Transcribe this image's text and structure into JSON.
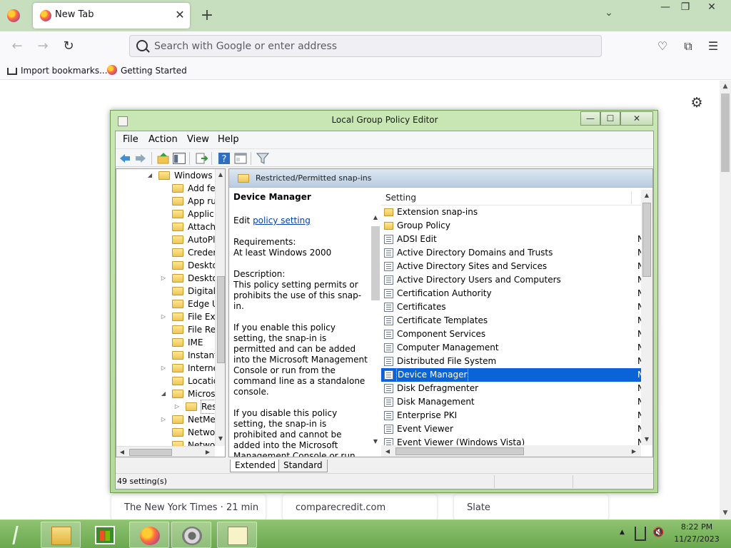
{
  "colors": {
    "tabstrip_bg": "#c7dfbf",
    "taskbar_bg": "#6aa84f",
    "selection_bg": "#0a64d8",
    "link": "#0645ad",
    "folder": "#f0c54f"
  },
  "browser": {
    "app_icon": "firefox-icon",
    "tab": {
      "title": "New Tab",
      "favicon": "firefox-icon",
      "close_glyph": "✕"
    },
    "new_tab_glyph": "+",
    "tab_list_glyph": "⌄",
    "window_controls": {
      "minimize": "—",
      "maximize": "❐",
      "close": "✕"
    },
    "nav": {
      "back_glyph": "←",
      "forward_glyph": "→",
      "reload_glyph": "↻"
    },
    "address_bar": {
      "placeholder": "Search with Google or enter address",
      "value": ""
    },
    "toolbar_icons": [
      "pocket-icon",
      "extensions-icon",
      "menu-icon"
    ],
    "toolbar_glyphs": {
      "pocket": "♡",
      "extensions": "⧉",
      "menu": "☰"
    },
    "bookmarks": [
      {
        "label": "Import bookmarks...",
        "icon": "import-icon"
      },
      {
        "label": "Getting Started",
        "icon": "firefox-icon"
      }
    ],
    "newtab": {
      "settings_glyph": "⚙",
      "cards": [
        "The New York Times · 21 min",
        "comparecredit.com",
        "Slate"
      ]
    }
  },
  "gpe": {
    "title": "Local Group Policy Editor",
    "controls": {
      "minimize": "—",
      "maximize": "☐",
      "close": "✕"
    },
    "menu": [
      "File",
      "Action",
      "View",
      "Help"
    ],
    "toolbar": [
      "back-icon",
      "forward-icon",
      "up-folder-icon",
      "show-hide-tree-icon",
      "export-list-icon",
      "help-icon",
      "properties-icon",
      "filter-icon"
    ],
    "tree": [
      {
        "label": "Windows (",
        "level": 0,
        "expander": "expanded"
      },
      {
        "label": "Add fe",
        "level": 1,
        "expander": "none"
      },
      {
        "label": "App ru",
        "level": 1,
        "expander": "none"
      },
      {
        "label": "Applic",
        "level": 1,
        "expander": "none"
      },
      {
        "label": "Attach",
        "level": 1,
        "expander": "none"
      },
      {
        "label": "AutoPl",
        "level": 1,
        "expander": "none"
      },
      {
        "label": "Creder",
        "level": 1,
        "expander": "none"
      },
      {
        "label": "Deskto",
        "level": 1,
        "expander": "none"
      },
      {
        "label": "Deskto",
        "level": 1,
        "expander": "collapsed"
      },
      {
        "label": "Digital",
        "level": 1,
        "expander": "none"
      },
      {
        "label": "Edge U",
        "level": 1,
        "expander": "none"
      },
      {
        "label": "File Exp",
        "level": 1,
        "expander": "collapsed"
      },
      {
        "label": "File Re",
        "level": 1,
        "expander": "none"
      },
      {
        "label": "IME",
        "level": 1,
        "expander": "none"
      },
      {
        "label": "Instant",
        "level": 1,
        "expander": "none"
      },
      {
        "label": "Interne",
        "level": 1,
        "expander": "collapsed"
      },
      {
        "label": "Locatio",
        "level": 1,
        "expander": "none"
      },
      {
        "label": "Micros",
        "level": 1,
        "expander": "expanded"
      },
      {
        "label": "Res",
        "level": 2,
        "expander": "collapsed",
        "selected": true
      },
      {
        "label": "NetMe",
        "level": 1,
        "expander": "collapsed"
      },
      {
        "label": "Netwo",
        "level": 1,
        "expander": "none"
      },
      {
        "label": "Netwo",
        "level": 1,
        "expander": "none"
      }
    ],
    "pane_header": "Restricted/Permitted snap-ins",
    "description": {
      "title": "Device Manager",
      "edit_prefix": "Edit ",
      "edit_link": "policy setting ",
      "requirements_label": "Requirements:",
      "requirements_value": "At least Windows 2000",
      "description_label": "Description:",
      "paragraphs": [
        "This policy setting permits or prohibits the use of this snap-in.",
        "If you enable this policy setting, the snap-in is permitted and can be added into the Microsoft Management Console or run from the command line as a standalone console.",
        "If you disable this policy setting, the snap-in is prohibited and cannot be added into the Microsoft Management Console or run from the command line as a standalone console. An error message is displayed stating that"
      ]
    },
    "list": {
      "column": "Setting",
      "rows": [
        {
          "name": "Extension snap-ins",
          "icon": "folder-icon",
          "state": ""
        },
        {
          "name": "Group Policy",
          "icon": "folder-icon",
          "state": ""
        },
        {
          "name": "ADSI Edit",
          "icon": "policy-setting-icon",
          "state": "N"
        },
        {
          "name": "Active Directory Domains and Trusts",
          "icon": "policy-setting-icon",
          "state": "N"
        },
        {
          "name": "Active Directory Sites and Services",
          "icon": "policy-setting-icon",
          "state": "N"
        },
        {
          "name": "Active Directory Users and Computers",
          "icon": "policy-setting-icon",
          "state": "N"
        },
        {
          "name": "Certification Authority",
          "icon": "policy-setting-icon",
          "state": "N"
        },
        {
          "name": "Certificates",
          "icon": "policy-setting-icon",
          "state": "N"
        },
        {
          "name": "Certificate Templates",
          "icon": "policy-setting-icon",
          "state": "N"
        },
        {
          "name": "Component Services",
          "icon": "policy-setting-icon",
          "state": "N"
        },
        {
          "name": "Computer Management",
          "icon": "policy-setting-icon",
          "state": "N"
        },
        {
          "name": "Distributed File System",
          "icon": "policy-setting-icon",
          "state": "N"
        },
        {
          "name": "Device Manager",
          "icon": "policy-setting-icon",
          "state": "N",
          "selected": true
        },
        {
          "name": "Disk Defragmenter",
          "icon": "policy-setting-icon",
          "state": "N"
        },
        {
          "name": "Disk Management",
          "icon": "policy-setting-icon",
          "state": "N"
        },
        {
          "name": "Enterprise PKI",
          "icon": "policy-setting-icon",
          "state": "N"
        },
        {
          "name": "Event Viewer",
          "icon": "policy-setting-icon",
          "state": "N"
        },
        {
          "name": "Event Viewer (Windows Vista)",
          "icon": "policy-setting-icon",
          "state": "N"
        }
      ]
    },
    "tabs": [
      "Extended",
      "Standard"
    ],
    "active_tab": "Extended",
    "status": "49 setting(s)"
  },
  "taskbar": {
    "items": [
      {
        "name": "start-icon",
        "active": false
      },
      {
        "name": "file-explorer-icon",
        "active": true
      },
      {
        "name": "store-icon",
        "active": false
      },
      {
        "name": "firefox-icon",
        "active": true
      },
      {
        "name": "settings-icon",
        "active": false
      },
      {
        "name": "notepad-icon",
        "active": true
      }
    ],
    "tray": {
      "up_glyph": "▲",
      "volume_glyph": "🔇"
    },
    "clock": {
      "time": "8:22 PM",
      "date": "11/27/2023"
    }
  }
}
